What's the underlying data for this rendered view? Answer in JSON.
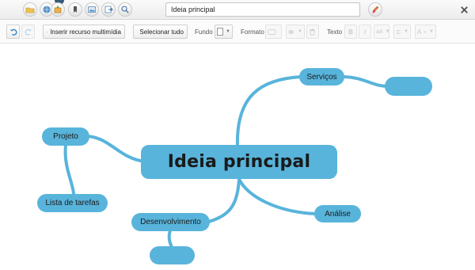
{
  "window": {
    "title_value": "Ideia principal",
    "top_icons": [
      "folder-open-icon",
      "globe-icon",
      "share-icon",
      "bookmark-icon",
      "image-icon",
      "export-icon",
      "search-zoom-icon"
    ],
    "close_icon": "close-icon",
    "brush_icon": "paint-brush-icon"
  },
  "toolbar": {
    "insert_media_label": "Inserir recurso multimídia",
    "select_all_label": "Selecionar tudo",
    "background_label": "Fundo",
    "format_label": "Formato",
    "text_label": "Texto",
    "text_bold": "B",
    "text_italic": "I",
    "text_font_color": "A",
    "text_size": "aA"
  },
  "mindmap": {
    "central": "Ideia principal",
    "nodes": {
      "servicos": "Serviços",
      "projeto": "Projeto",
      "lista_tarefas": "Lista de tarefas",
      "desenvolvimento": "Desenvolvimento",
      "analise": "Análise",
      "empty_right": "",
      "empty_bottom": ""
    },
    "node_color": "#58b4db",
    "link_color": "#58b4db"
  }
}
